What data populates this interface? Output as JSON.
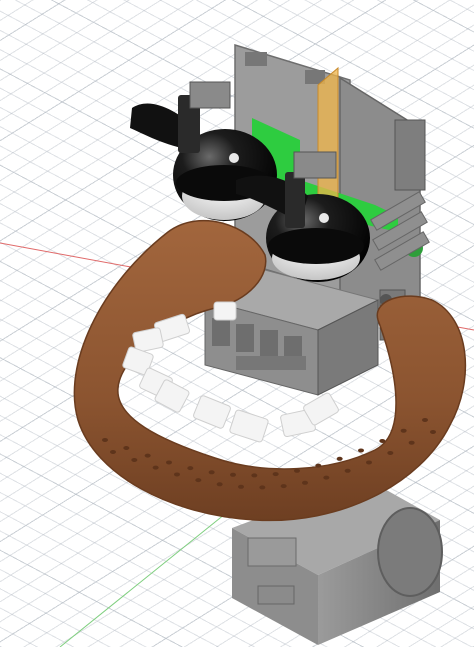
{
  "viewport": {
    "type": "3d-cad-canvas",
    "grid": true,
    "axes": {
      "x_axis_color": "#d9534f",
      "y_axis_color": "#5cb85c"
    }
  },
  "model": {
    "parts": [
      "bracket-frame",
      "green-panel",
      "amber-rod",
      "left-eye",
      "right-eye",
      "left-eyebrow",
      "right-eyebrow",
      "lip",
      "teeth",
      "servo-block",
      "base-block"
    ],
    "colors": {
      "lip": "#8b5430",
      "bracket": "#8f8f8f",
      "green_panel": "#2ecc40",
      "amber_rod": "#f0b64a",
      "eye_shell": "#111111",
      "eye_white": "#e8e8e8",
      "teeth": "#f4f4f4",
      "base": "#8a8a8a"
    },
    "teeth_count": 10
  }
}
